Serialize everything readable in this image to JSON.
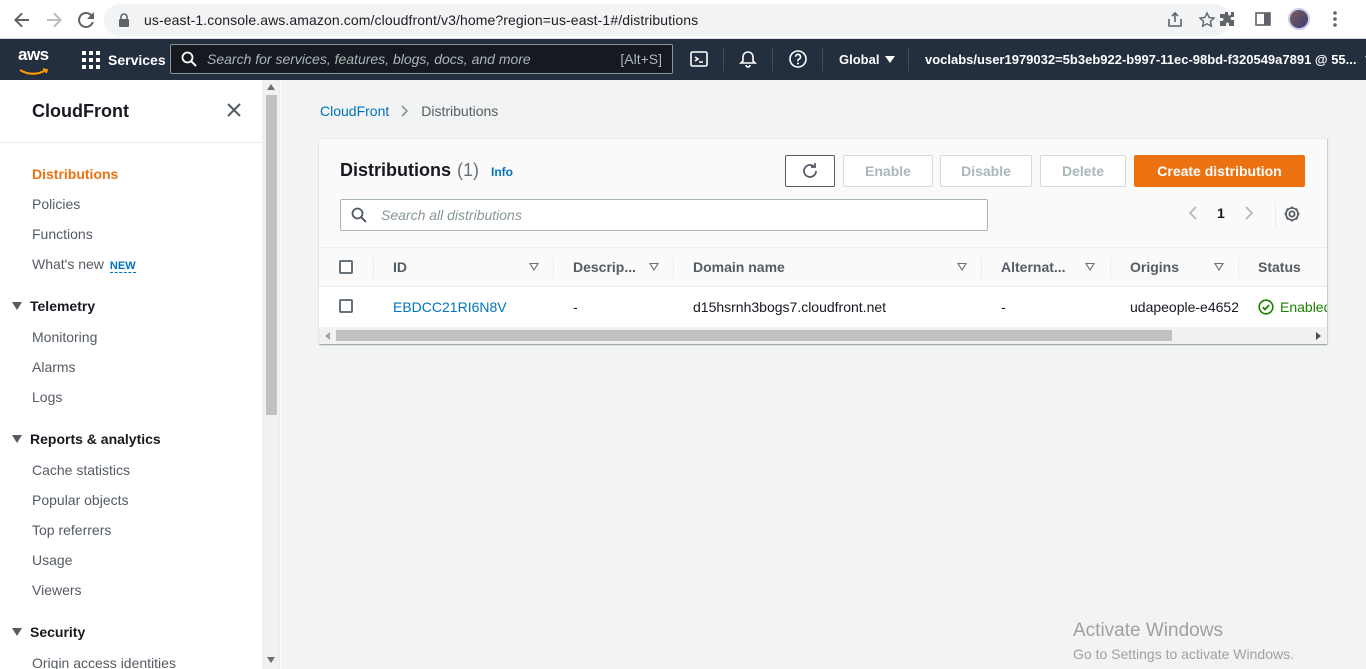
{
  "browser": {
    "url": "us-east-1.console.aws.amazon.com/cloudfront/v3/home?region=us-east-1#/distributions"
  },
  "aws_nav": {
    "logo_text": "aws",
    "services_label": "Services",
    "search_placeholder": "Search for services, features, blogs, docs, and more",
    "search_shortcut": "[Alt+S]",
    "region_label": "Global",
    "account_label": "voclabs/user1979032=5b3eb922-b997-11ec-98bd-f320549a7891 @ 55..."
  },
  "sidebar": {
    "title": "CloudFront",
    "items": [
      {
        "label": "Distributions",
        "active": true
      },
      {
        "label": "Policies"
      },
      {
        "label": "Functions"
      },
      {
        "label": "What's new",
        "badge": "NEW"
      }
    ],
    "sections": [
      {
        "title": "Telemetry",
        "items": [
          "Monitoring",
          "Alarms",
          "Logs"
        ]
      },
      {
        "title": "Reports & analytics",
        "items": [
          "Cache statistics",
          "Popular objects",
          "Top referrers",
          "Usage",
          "Viewers"
        ]
      },
      {
        "title": "Security",
        "items": [
          "Origin access identities"
        ]
      }
    ]
  },
  "breadcrumb": {
    "root": "CloudFront",
    "current": "Distributions"
  },
  "panel": {
    "title": "Distributions",
    "count": "(1)",
    "info": "Info",
    "buttons": {
      "enable": "Enable",
      "disable": "Disable",
      "delete": "Delete",
      "create": "Create distribution"
    },
    "search_placeholder": "Search all distributions",
    "page": "1"
  },
  "table": {
    "columns": [
      "ID",
      "Descrip...",
      "Domain name",
      "Alternat...",
      "Origins",
      "Status"
    ],
    "rows": [
      {
        "id": "EBDCC21RI6N8V",
        "description": "-",
        "domain": "d15hsrnh3bogs7.cloudfront.net",
        "alternate": "-",
        "origins": "udapeople-e4652",
        "status": "Enabled"
      }
    ]
  },
  "colors": {
    "accent": "#ec7211",
    "link": "#0073bb",
    "nav_bg": "#232f3e",
    "success": "#1d8102"
  },
  "watermark": {
    "line1": "Activate Windows",
    "line2": "Go to Settings to activate Windows."
  }
}
